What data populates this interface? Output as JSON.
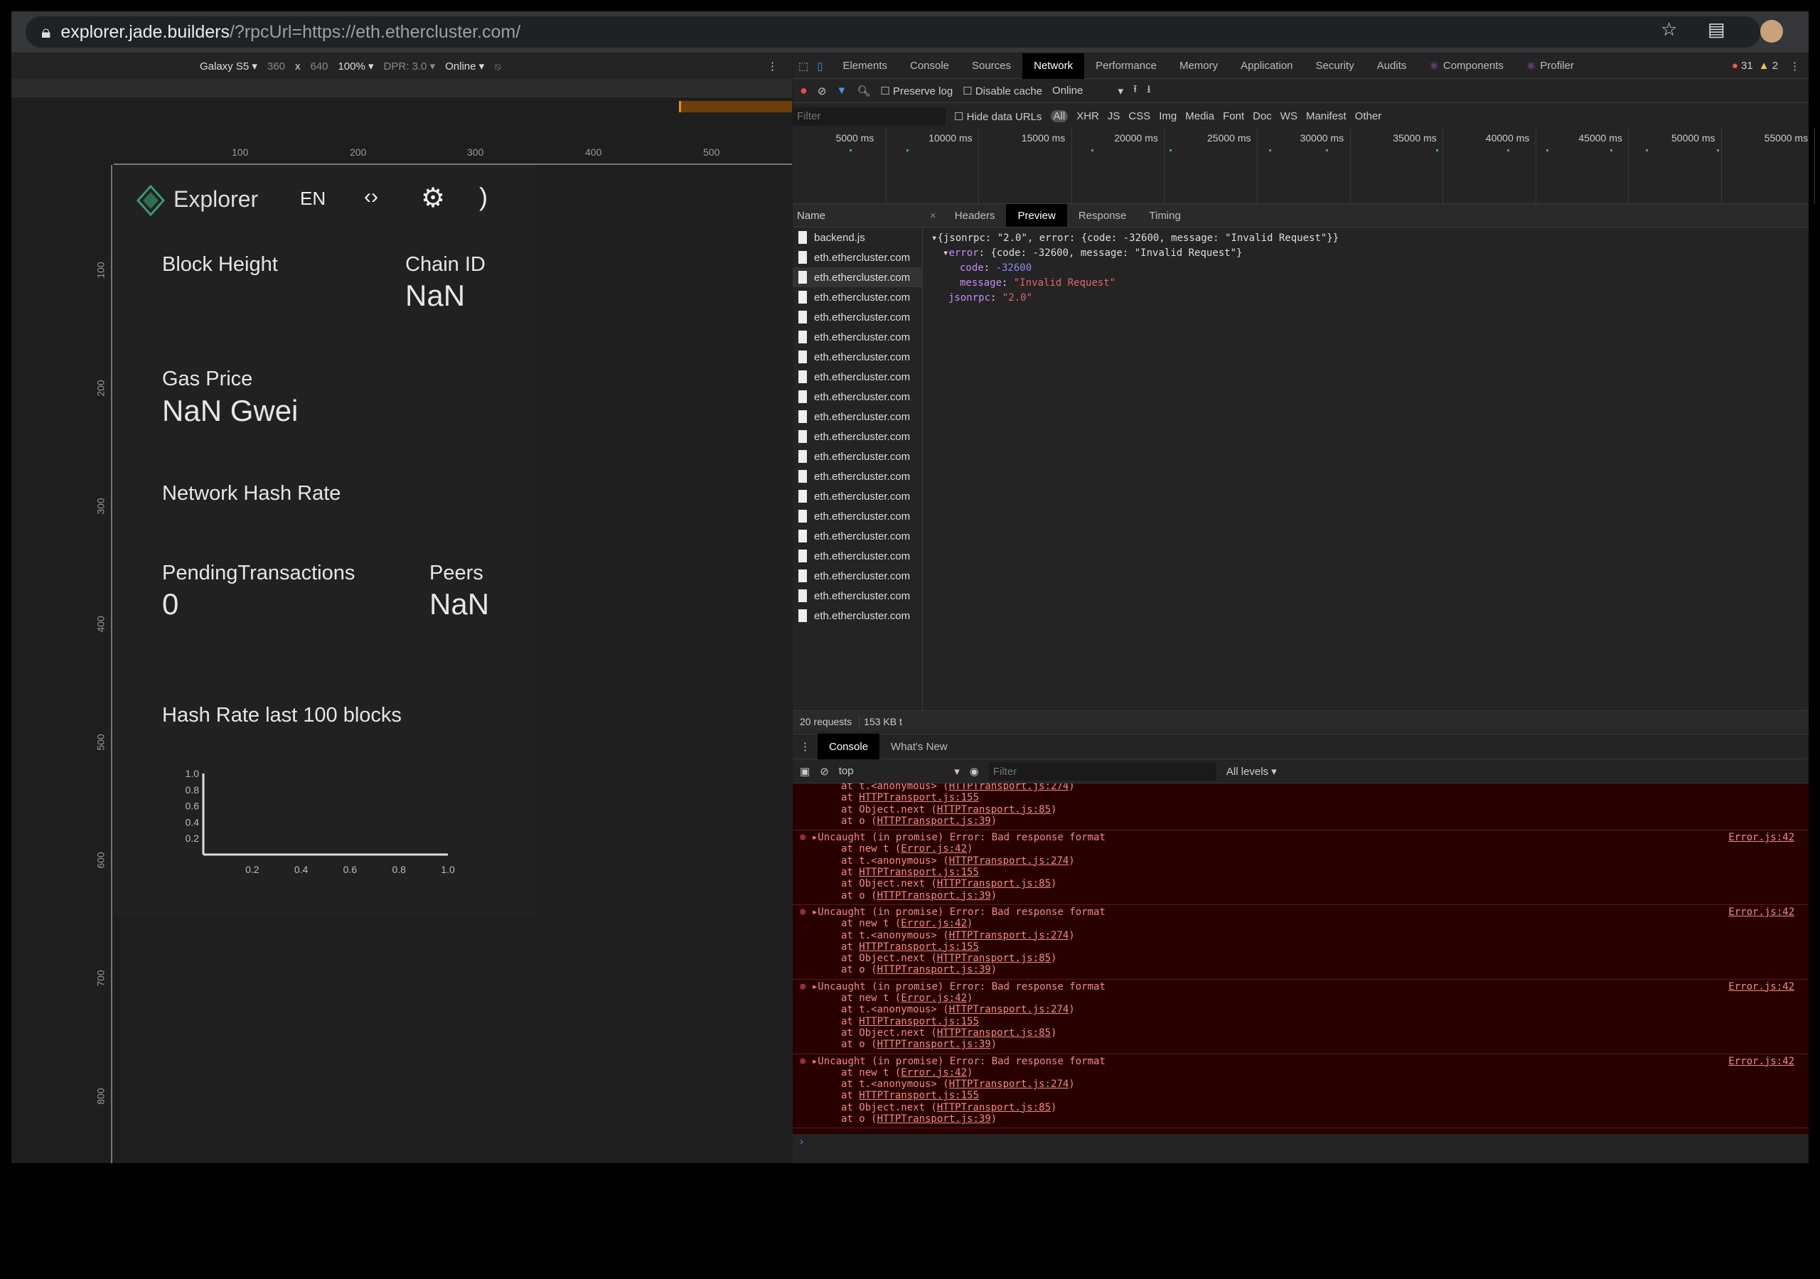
{
  "browser": {
    "url_host": "explorer.jade.builders",
    "url_path": "/?rpcUrl=https://eth.ethercluster.com/"
  },
  "device_toolbar": {
    "device": "Galaxy S5",
    "width": "360",
    "x": "x",
    "height": "640",
    "zoom": "100%",
    "dpr": "DPR: 3.0",
    "throttle": "Online"
  },
  "rulers": {
    "h": [
      "100",
      "200",
      "300",
      "400",
      "500"
    ],
    "v": [
      "100",
      "200",
      "300",
      "400",
      "500",
      "600",
      "700",
      "800"
    ]
  },
  "app": {
    "title": "Explorer",
    "lang": "EN",
    "stats": {
      "block_height_label": "Block Height",
      "chain_id_label": "Chain ID",
      "chain_id_value": "NaN",
      "gas_price_label": "Gas Price",
      "gas_price_value": "NaN Gwei",
      "hash_rate_label": "Network Hash Rate",
      "pending_label": "PendingTransactions",
      "pending_value": "0",
      "peers_label": "Peers",
      "peers_value": "NaN",
      "chart_title": "Hash Rate last 100 blocks"
    }
  },
  "chart_data": {
    "type": "line",
    "title": "Hash Rate last 100 blocks",
    "xlim": [
      0,
      1
    ],
    "ylim": [
      0,
      1
    ],
    "x_ticks": [
      "0.2",
      "0.4",
      "0.6",
      "0.8",
      "1.0"
    ],
    "y_ticks": [
      "1.0",
      "0.8",
      "0.6",
      "0.4",
      "0.2"
    ],
    "series": []
  },
  "devtools": {
    "tabs": [
      "Elements",
      "Console",
      "Sources",
      "Network",
      "Performance",
      "Memory",
      "Application",
      "Security",
      "Audits",
      "Components",
      "Profiler"
    ],
    "active_tab": "Network",
    "errors": "31",
    "warnings": "2",
    "net_toolbar": {
      "preserve_log": "Preserve log",
      "disable_cache": "Disable cache",
      "throttle": "Online"
    },
    "filter": {
      "placeholder": "Filter",
      "hide_data_urls": "Hide data URLs",
      "types": [
        "All",
        "XHR",
        "JS",
        "CSS",
        "Img",
        "Media",
        "Font",
        "Doc",
        "WS",
        "Manifest",
        "Other"
      ]
    },
    "timeline": [
      "5000 ms",
      "10000 ms",
      "15000 ms",
      "20000 ms",
      "25000 ms",
      "30000 ms",
      "35000 ms",
      "40000 ms",
      "45000 ms",
      "50000 ms",
      "55000 ms"
    ],
    "name_header": "Name",
    "detail_tabs": [
      "Headers",
      "Preview",
      "Response",
      "Timing"
    ],
    "active_detail": "Preview",
    "requests": [
      "backend.js",
      "eth.ethercluster.com",
      "eth.ethercluster.com",
      "eth.ethercluster.com",
      "eth.ethercluster.com",
      "eth.ethercluster.com",
      "eth.ethercluster.com",
      "eth.ethercluster.com",
      "eth.ethercluster.com",
      "eth.ethercluster.com",
      "eth.ethercluster.com",
      "eth.ethercluster.com",
      "eth.ethercluster.com",
      "eth.ethercluster.com",
      "eth.ethercluster.com",
      "eth.ethercluster.com",
      "eth.ethercluster.com",
      "eth.ethercluster.com",
      "eth.ethercluster.com",
      "eth.ethercluster.com"
    ],
    "preview": {
      "root": "{jsonrpc: \"2.0\", error: {code: -32600, message: \"Invalid Request\"}}",
      "error_key": "error",
      "error_summary": ": {code: -32600, message: \"Invalid Request\"}",
      "code_key": "code",
      "code_val": "-32600",
      "message_key": "message",
      "message_val": "\"Invalid Request\"",
      "jsonrpc_key": "jsonrpc",
      "jsonrpc_val": "\"2.0\""
    },
    "status": {
      "requests": "20 requests",
      "size": "153 KB t"
    },
    "drawer_tabs": [
      "Console",
      "What's New"
    ],
    "console_toolbar": {
      "context": "top",
      "filter_placeholder": "Filter",
      "levels": "All levels"
    },
    "console": {
      "partial": [
        "at t.<anonymous> (HTTPTransport.js:274)",
        "at HTTPTransport.js:155",
        "at Object.next (HTTPTransport.js:85)",
        "at o (HTTPTransport.js:39)"
      ],
      "error": {
        "message": "Uncaught (in promise) Error: Bad response format",
        "source": "Error.js:42",
        "stack": [
          "at new t (Error.js:42)",
          "at t.<anonymous> (HTTPTransport.js:274)",
          "at HTTPTransport.js:155",
          "at Object.next (HTTPTransport.js:85)",
          "at o (HTTPTransport.js:39)"
        ]
      },
      "error_count": 4
    }
  }
}
